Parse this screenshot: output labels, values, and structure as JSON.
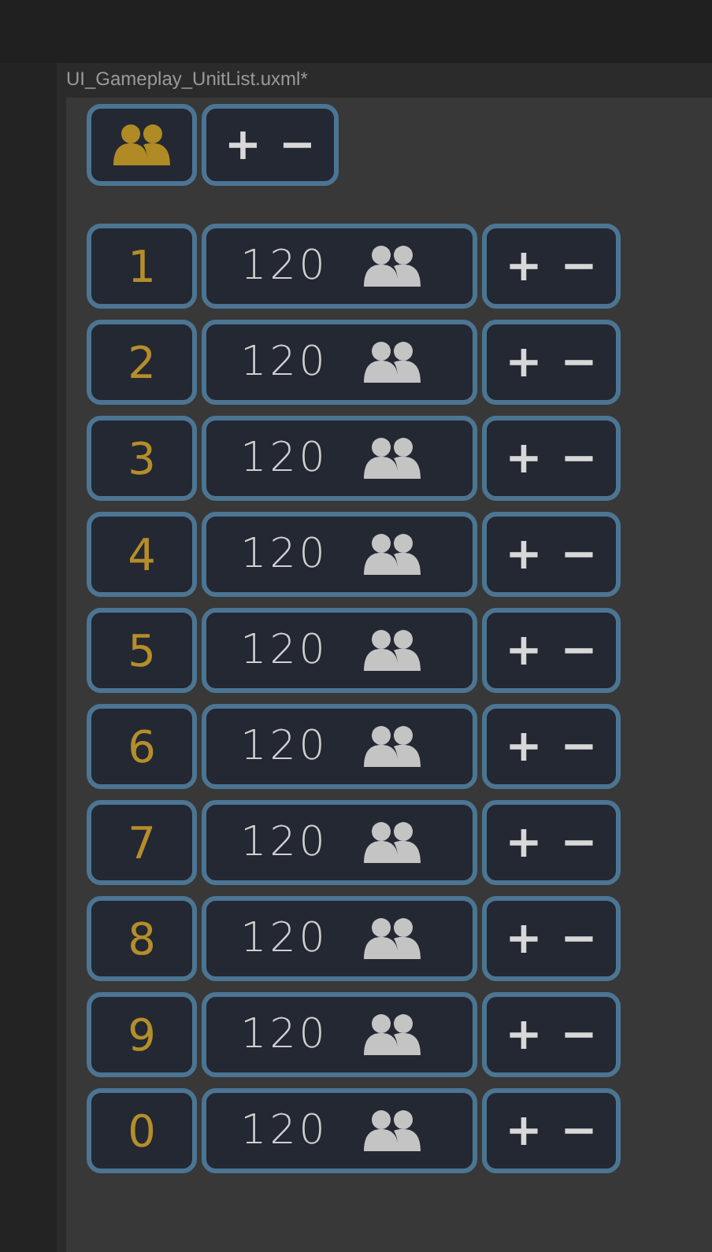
{
  "document_tab": {
    "title": "UI_Gameplay_UnitList.uxml*"
  },
  "header": {
    "plus": "+",
    "minus": "−"
  },
  "units": [
    {
      "number": "1",
      "count": "120",
      "plus": "+",
      "minus": "−"
    },
    {
      "number": "2",
      "count": "120",
      "plus": "+",
      "minus": "−"
    },
    {
      "number": "3",
      "count": "120",
      "plus": "+",
      "minus": "−"
    },
    {
      "number": "4",
      "count": "120",
      "plus": "+",
      "minus": "−"
    },
    {
      "number": "5",
      "count": "120",
      "plus": "+",
      "minus": "−"
    },
    {
      "number": "6",
      "count": "120",
      "plus": "+",
      "minus": "−"
    },
    {
      "number": "7",
      "count": "120",
      "plus": "+",
      "minus": "−"
    },
    {
      "number": "8",
      "count": "120",
      "plus": "+",
      "minus": "−"
    },
    {
      "number": "9",
      "count": "120",
      "plus": "+",
      "minus": "−"
    },
    {
      "number": "0",
      "count": "120",
      "plus": "+",
      "minus": "−"
    }
  ]
}
